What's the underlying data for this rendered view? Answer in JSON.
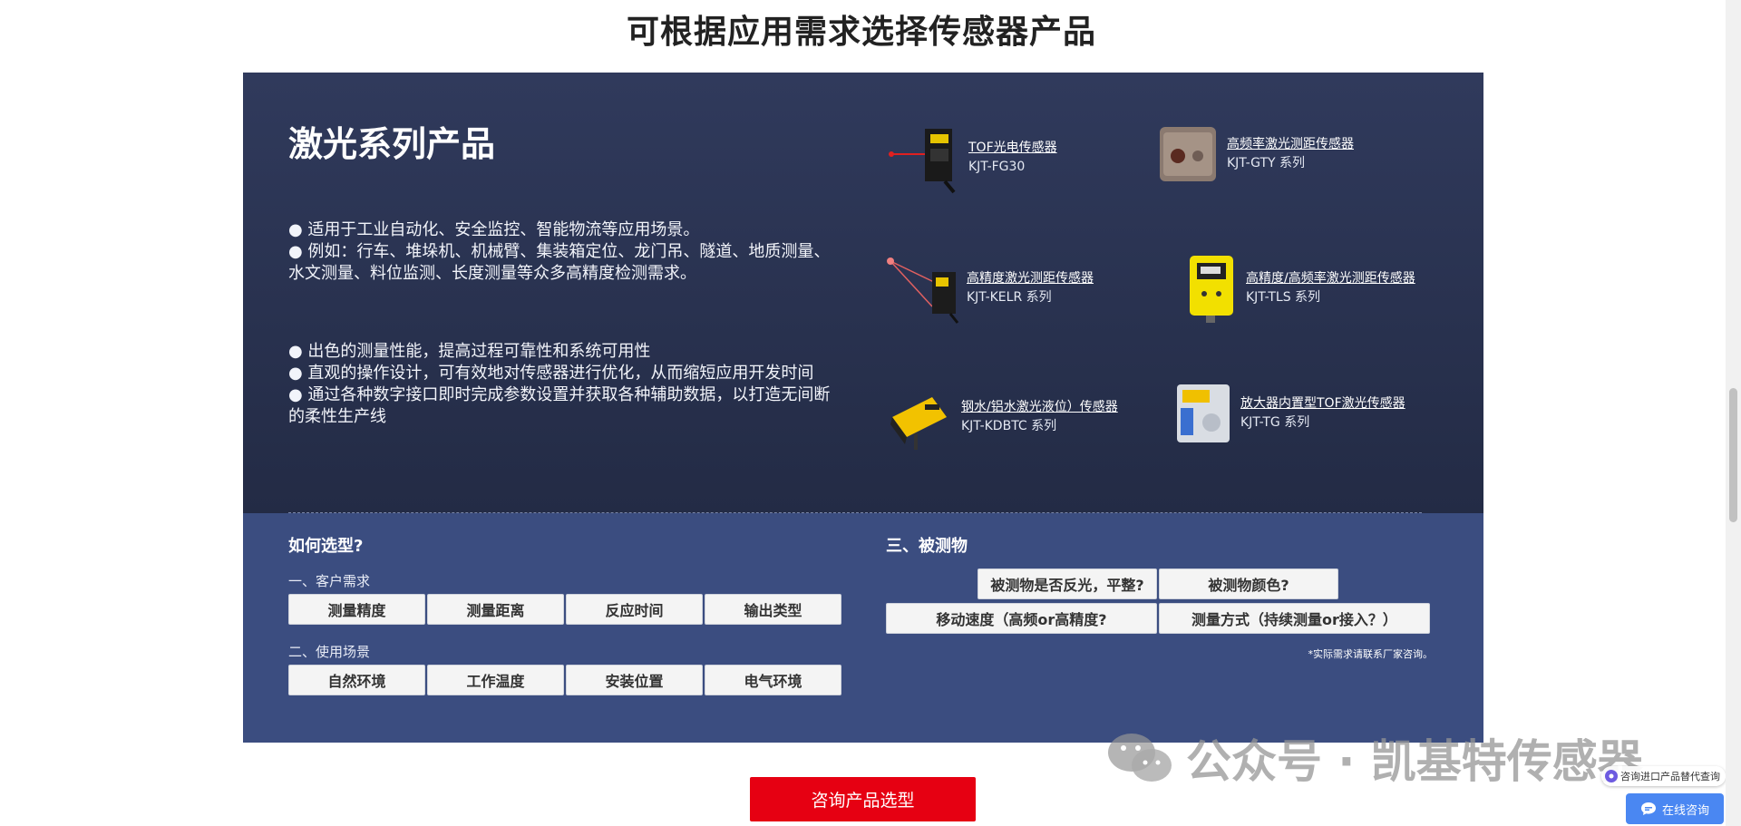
{
  "page": {
    "title": "可根据应用需求选择传感器产品"
  },
  "laser": {
    "title": "激光系列产品",
    "bullets_group1": [
      "● 适用于工业自动化、安全监控、智能物流等应用场景。",
      "● 例如：行车、堆垛机、机械臂、集装箱定位、龙门吊、隧道、地质测量、水文测量、料位监测、长度测量等众多高精度检测需求。"
    ],
    "bullets_group2": [
      "● 出色的测量性能，提高过程可靠性和系统可用性",
      "● 直观的操作设计，可有效地对传感器进行优化，从而缩短应用开发时间",
      "● 通过各种数字接口即时完成参数设置并获取各种辅助数据，以打造无间断的柔性生产线"
    ],
    "products": [
      {
        "name": "TOF光电传感器",
        "model": "KJT-FG30",
        "icon": "tof-photoelectric-sensor-icon"
      },
      {
        "name": "高频率激光测距传感器",
        "model": "KJT-GTY 系列",
        "icon": "high-frequency-laser-sensor-icon"
      },
      {
        "name": "高精度激光测距传感器",
        "model": "KJT-KELR 系列",
        "icon": "high-precision-laser-sensor-icon"
      },
      {
        "name": "高精度/高频率激光测距传感器",
        "model": "KJT-TLS 系列",
        "icon": "yellow-laser-sensor-icon"
      },
      {
        "name": "钢水/铝水激光液位）传感器",
        "model": "KJT-KDBTC 系列",
        "icon": "liquid-level-sensor-icon"
      },
      {
        "name": "放大器内置型TOF激光传感器",
        "model": "KJT-TG 系列",
        "icon": "amplifier-tof-sensor-icon"
      }
    ]
  },
  "selection": {
    "title": "如何选型?",
    "customer_label": "一、客户需求",
    "customer_buttons": [
      "测量精度",
      "测量距离",
      "反应时间",
      "输出类型"
    ],
    "scene_label": "二、使用场景",
    "scene_buttons": [
      "自然环境",
      "工作温度",
      "安装位置",
      "电气环境"
    ],
    "object_title": "三、被测物",
    "object_row1": [
      "被测物是否反光，平整?",
      "被测物颜色?"
    ],
    "object_row2": [
      "移动速度（高频or高精度?",
      "测量方式（持续测量or接入？）"
    ],
    "note": "*实际需求请联系厂家咨询。"
  },
  "cta": {
    "label": "咨询产品选型"
  },
  "watermark": {
    "text": "公众号 · 凯基特传感器"
  },
  "floating": {
    "link_label": "咨询进口产品替代查询",
    "chat_label": "在线咨询"
  },
  "colors": {
    "dark_panel": "#2a3350",
    "blue_panel": "#3b4d80",
    "cta": "#e60012",
    "chat": "#4a87f2"
  }
}
